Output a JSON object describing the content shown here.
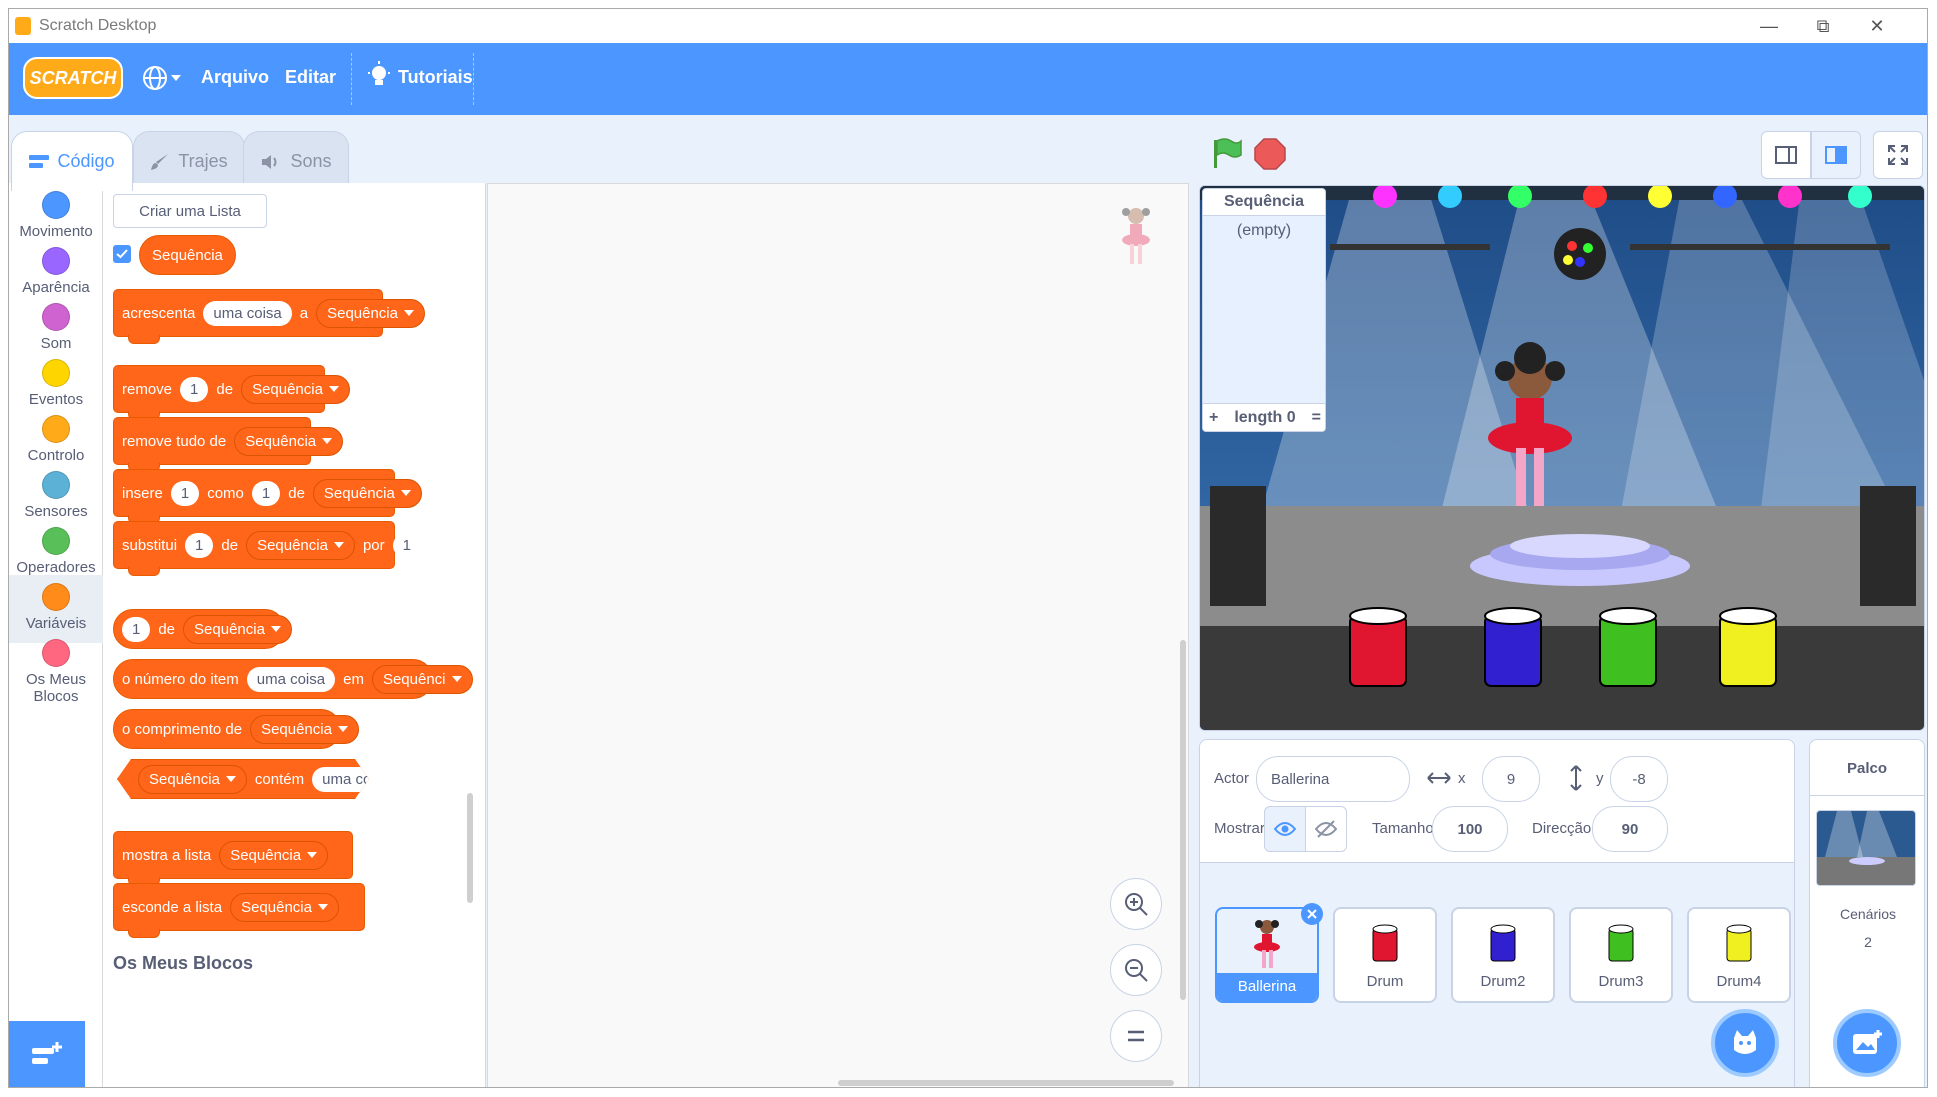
{
  "window": {
    "title": "Scratch Desktop",
    "minimize": "—",
    "maximize": "⧉",
    "close": "✕"
  },
  "menu": {
    "logo": "SCRATCH",
    "file": "Arquivo",
    "edit": "Editar",
    "tutorials": "Tutoriais"
  },
  "tabs": {
    "code": "Código",
    "costumes": "Trajes",
    "sounds": "Sons"
  },
  "categories": [
    {
      "label": "Movimento",
      "color": "#4c97ff"
    },
    {
      "label": "Aparência",
      "color": "#9966ff"
    },
    {
      "label": "Som",
      "color": "#cf63cf"
    },
    {
      "label": "Eventos",
      "color": "#ffd500"
    },
    {
      "label": "Controlo",
      "color": "#ffab19"
    },
    {
      "label": "Sensores",
      "color": "#5cb1d6"
    },
    {
      "label": "Operadores",
      "color": "#59c059"
    },
    {
      "label": "Variáveis",
      "color": "#ff8c1a"
    },
    {
      "label": "Os Meus Blocos",
      "color": "#ff6680"
    }
  ],
  "palette": {
    "make_list": "Criar uma Lista",
    "list_name": "Sequência",
    "add": {
      "w1": "acrescenta",
      "val": "uma coisa",
      "w2": "a"
    },
    "remove": {
      "w1": "remove",
      "n": "1",
      "w2": "de"
    },
    "remove_all": {
      "w1": "remove tudo de"
    },
    "insert": {
      "w1": "insere",
      "n1": "1",
      "w2": "como",
      "n2": "1",
      "w3": "de"
    },
    "replace": {
      "w1": "substitui",
      "n1": "1",
      "w2": "de",
      "w3": "por",
      "n2": "1"
    },
    "item": {
      "n": "1",
      "w1": "de"
    },
    "item_num": {
      "w1": "o número do item",
      "val": "uma coisa",
      "w2": "em",
      "list": "Sequênci"
    },
    "length": {
      "w1": "o comprimento de"
    },
    "contains": {
      "w1": "contém",
      "val": "uma coisa"
    },
    "show": {
      "w1": "mostra a lista"
    },
    "hide": {
      "w1": "esconde a lista"
    },
    "section": "Os Meus Blocos"
  },
  "stage_monitor": {
    "title": "Sequência",
    "content": "(empty)",
    "plus": "+",
    "length": "length 0",
    "eq": "="
  },
  "sprite_info": {
    "sprite_label": "Actor",
    "sprite_name": "Ballerina",
    "x_label": "x",
    "x": "9",
    "y_label": "y",
    "y": "-8",
    "show_label": "Mostrar",
    "size_label": "Tamanho",
    "size": "100",
    "direction_label": "Direcção",
    "direction": "90"
  },
  "sprites": [
    "Ballerina",
    "Drum",
    "Drum2",
    "Drum3",
    "Drum4"
  ],
  "stage_panel": {
    "title": "Palco",
    "backdrops_label": "Cenários",
    "backdrops_count": "2"
  }
}
